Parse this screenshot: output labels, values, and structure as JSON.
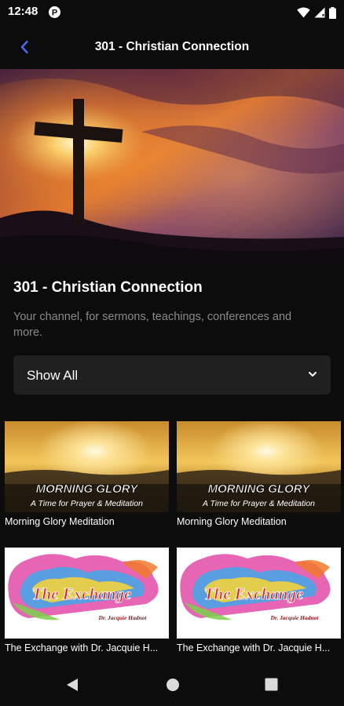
{
  "status_bar": {
    "time": "12:48",
    "app_icon": "app-badge-icon",
    "icons": [
      "wifi-icon",
      "cell-signal-icon",
      "battery-icon"
    ]
  },
  "app_bar": {
    "back_icon": "chevron-left-icon",
    "title": "301 - Christian Connection"
  },
  "hero": {
    "image": "cross-at-sunset-image"
  },
  "channel": {
    "title": "301 - Christian Connection",
    "description": "Your channel, for sermons, teachings, conferences and more."
  },
  "filter": {
    "selected": "Show All",
    "icon": "chevron-down-icon"
  },
  "videos": [
    {
      "title": "Morning Glory Meditation",
      "thumb": "morning-glory-thumbnail",
      "thumb_text": {
        "heading": "MORNING GLORY",
        "sub": "A Time for Prayer & Meditation"
      }
    },
    {
      "title": "Morning Glory Meditation",
      "thumb": "morning-glory-thumbnail",
      "thumb_text": {
        "heading": "MORNING GLORY",
        "sub": "A Time for Prayer & Meditation"
      }
    },
    {
      "title": "The Exchange with Dr. Jacquie H...",
      "thumb": "the-exchange-thumbnail",
      "thumb_text": {
        "heading": "The Exchange",
        "sub": "Dr. Jacquie Hadnot"
      }
    },
    {
      "title": "The Exchange with Dr. Jacquie H...",
      "thumb": "the-exchange-thumbnail",
      "thumb_text": {
        "heading": "The Exchange",
        "sub": "Dr. Jacquie Hadnot"
      }
    }
  ],
  "nav_bar": {
    "icons": [
      "nav-back-icon",
      "nav-home-icon",
      "nav-recents-icon"
    ]
  },
  "colors": {
    "background": "#0c0c0c",
    "accent": "#4a6cf7",
    "muted_text": "#8a8a8a",
    "select_bg": "#202020"
  }
}
